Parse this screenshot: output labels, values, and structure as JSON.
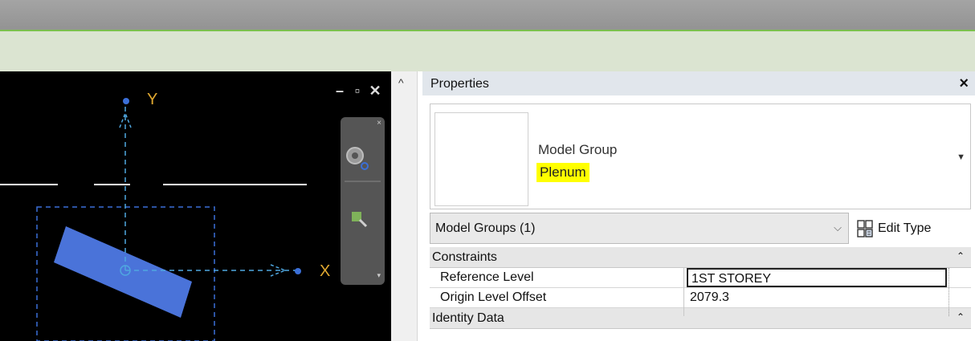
{
  "viewport": {
    "axis_x_label": "X",
    "axis_y_label": "Y",
    "window_controls": {
      "minimize": "–",
      "restore": "▫",
      "close": "✕"
    },
    "nav_close": "×",
    "nav_scroll": "▾",
    "scroll_up": "^"
  },
  "properties": {
    "title": "Properties",
    "close_label": "×",
    "type_selector": {
      "family": "Model Group",
      "type_name": "Plenum",
      "dropdown": "▼"
    },
    "selection_filter": {
      "value": "Model Groups (1)",
      "dropdown": "⌵"
    },
    "edit_type_label": "Edit Type",
    "groups": [
      {
        "title": "Constraints",
        "collapse": "⌃",
        "rows": [
          {
            "name": "Reference Level",
            "value": "1ST STOREY"
          },
          {
            "name": "Origin Level Offset",
            "value": "2079.3"
          }
        ]
      },
      {
        "title": "Identity Data",
        "collapse": "⌃"
      }
    ]
  },
  "colors": {
    "highlight": "#ffff00",
    "axis_label": "#e0a830",
    "element_fill": "#4a73d9",
    "dashed_line": "#4fa7e0"
  }
}
